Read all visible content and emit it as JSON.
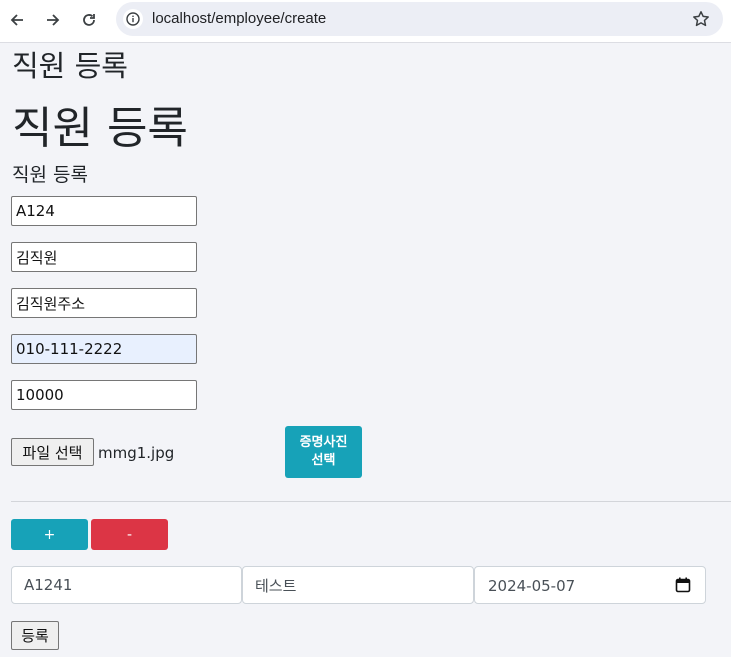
{
  "browser": {
    "url": "localhost/employee/create",
    "icons": {
      "back": "back-arrow-icon",
      "forward": "forward-arrow-icon",
      "reload": "reload-icon",
      "info": "info-icon",
      "bookmark": "bookmark-star-icon"
    }
  },
  "page": {
    "heading_small": "직원 등록",
    "heading_large": "직원 등록",
    "form_label": "직원 등록"
  },
  "form": {
    "employee_id": "A124",
    "name": "김직원",
    "address": "김직원주소",
    "phone": "010-111-2222",
    "salary": "10000",
    "file_button_label": "파일 선택",
    "file_name": "mmg1.jpg",
    "photo_button_line1": "증명사진",
    "photo_button_line2": "선택"
  },
  "row_controls": {
    "add_label": "+",
    "remove_label": "-"
  },
  "detail_row": {
    "code": "A1241",
    "description": "테스트",
    "date": "2024-05-07"
  },
  "submit_label": "등록",
  "colors": {
    "accent": "#17a2b8",
    "danger": "#dc3545",
    "autofill": "#e8f0fe"
  }
}
